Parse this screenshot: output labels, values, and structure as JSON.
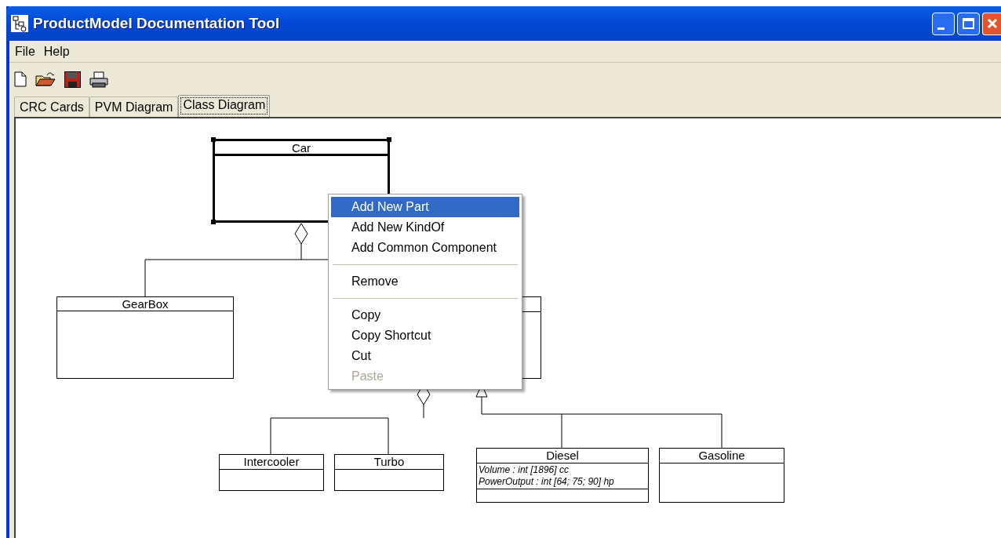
{
  "window": {
    "title": "ProductModel Documentation Tool"
  },
  "menu_bar": [
    "File",
    "Help"
  ],
  "tabs": [
    {
      "label": "CRC Cards",
      "selected": false
    },
    {
      "label": "PVM Diagram",
      "selected": false
    },
    {
      "label": "Class Diagram",
      "selected": true
    }
  ],
  "diagram": {
    "classes": [
      {
        "name": "Car",
        "selected": true
      },
      {
        "name": "GearBox",
        "selected": false
      },
      {
        "name": "Intercooler",
        "selected": false
      },
      {
        "name": "Turbo",
        "selected": false
      },
      {
        "name": "Diesel",
        "attributes": [
          "Volume : int [1896] cc",
          "PowerOutput : int [64; 75; 90] hp"
        ],
        "selected": false
      },
      {
        "name": "Gasoline",
        "selected": false
      }
    ],
    "connectors": [
      {
        "kind": "aggregation"
      },
      {
        "kind": "aggregation"
      },
      {
        "kind": "generalization"
      }
    ]
  },
  "context_menu": [
    {
      "kind": "item",
      "label": "Add New Part",
      "selected": true,
      "disabled": false
    },
    {
      "kind": "item",
      "label": "Add New KindOf",
      "selected": false,
      "disabled": false
    },
    {
      "kind": "item",
      "label": "Add Common Component",
      "selected": false,
      "disabled": false
    },
    {
      "kind": "separator"
    },
    {
      "kind": "item",
      "label": "Remove",
      "selected": false,
      "disabled": false
    },
    {
      "kind": "separator"
    },
    {
      "kind": "item",
      "label": "Copy",
      "selected": false,
      "disabled": false
    },
    {
      "kind": "item",
      "label": "Copy Shortcut",
      "selected": false,
      "disabled": false
    },
    {
      "kind": "item",
      "label": "Cut",
      "selected": false,
      "disabled": false
    },
    {
      "kind": "item",
      "label": "Paste",
      "selected": false,
      "disabled": true
    }
  ]
}
